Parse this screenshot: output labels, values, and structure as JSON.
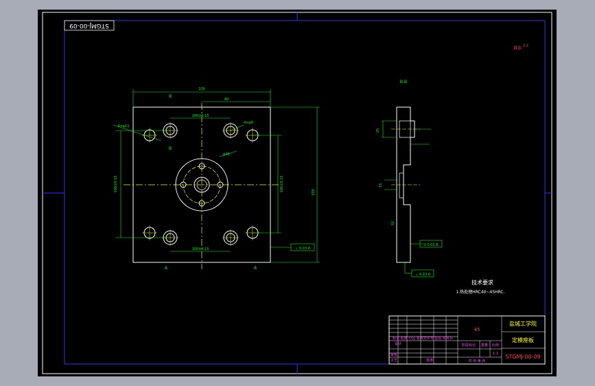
{
  "drawing_number": "STGMJ-00-09",
  "roughness_note": "其余",
  "roughness_value": "3.2",
  "section_label": "B-B",
  "front_view": {
    "width_dim": "100",
    "height_dim": "100",
    "top_dim_2": "40",
    "hole_pitch_h": "100±0.15",
    "hole_pitch_v": "100±0.15",
    "hole_pitch_h_bottom": "100±0.15",
    "hole_pitch_v_left": "100±0.15",
    "hole_callout_1": "4×φ11",
    "hole_callout_2": "4×φ9",
    "center_callout": "φ40",
    "section_mark": "B",
    "datum_bottom": "A",
    "tolerance_frame": "⊥ 0.03 A"
  },
  "section_view": {
    "tol_frame_1": "// 0.02 B",
    "tol_frame_2": "⊥ 0.03 A",
    "dim_1": "25",
    "dim_2": "15",
    "dim_3": "32"
  },
  "tech_req": {
    "title": "技术要求",
    "line1": "1.热处理HRC40~45HRC."
  },
  "title_block": {
    "material": "45",
    "school": "盐城工学院",
    "part_name": "定模座板",
    "code": "STGMJ-00-09",
    "scale_label": "比例",
    "scale_value": "1:1",
    "qty_label": "数量",
    "weight_label": "重量",
    "sheet": "共 张 第 张",
    "designer": "设计",
    "checker": "审核",
    "process": "工艺",
    "stage": "阶段标记",
    "revision": "标记 处数 分区 更改文件号 签名 年月日",
    "approve": "批准"
  },
  "colors": {
    "background": "#a8acb6",
    "sheet": "#000000",
    "frame": "#ffffff",
    "border": "#3030ff",
    "outline": "#ffffff",
    "dims": "#00ff00",
    "center": "#ffff00",
    "text_red": "#ff4040",
    "text_magenta": "#ff40ff",
    "text_yellow": "#ffff00"
  }
}
